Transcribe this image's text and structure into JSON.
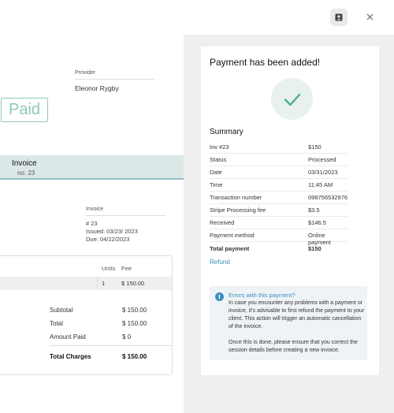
{
  "toolbar": {
    "contacts_icon": "contact-card-icon",
    "close_icon": "close-icon"
  },
  "invoice": {
    "provider_label": "Provider",
    "provider_name": "Eleonor Rygby",
    "stamp": "Paid",
    "title": "Invoice",
    "number": "no. 23",
    "meta_label": "Invoice",
    "meta": [
      "# 23",
      "Issued: 03/23/ 2023",
      "Due: 04/22/2023"
    ],
    "table": {
      "headers": [
        "Units",
        "Fee"
      ],
      "rows": [
        {
          "units": "1",
          "fee": "$ 150.00"
        }
      ]
    },
    "totals": [
      {
        "label": "Subtotal",
        "value": "$ 150.00"
      },
      {
        "label": "Total",
        "value": "$ 150.00"
      },
      {
        "label": "Amount Paid",
        "value": "$ 0"
      }
    ],
    "total_charges": {
      "label": "Total Charges",
      "value": "$ 150.00"
    }
  },
  "payment": {
    "title": "Payment has been added!",
    "summary_title": "Summary",
    "rows": [
      {
        "label": "Inv #23",
        "value": "$150"
      },
      {
        "label": "Status",
        "value": "Processed"
      },
      {
        "label": "Date",
        "value": "03/31/2023"
      },
      {
        "label": "Time",
        "value": "11:45 AM"
      },
      {
        "label": "Transaction number",
        "value": "098756532976"
      },
      {
        "label": "Stripe Processing fee",
        "value": "$3.5"
      },
      {
        "label": "Received",
        "value": "$146.5"
      },
      {
        "label": "Payment method",
        "value": "Online payment"
      },
      {
        "label": "Total payment",
        "value": "$150"
      }
    ],
    "refund_label": "Refund",
    "alert": {
      "icon": "i",
      "title": "Errors with this payment?",
      "p1": "In case you encounter any problems with a payment or invoice, it's advisable to first refund the payment to your client. This action will trigger an automatic cancellation of the invoice.",
      "p2": "Once this is done, please ensure that you correct the session details before creating a new invoice."
    }
  },
  "colors": {
    "accent": "#3a8fbf",
    "success": "#4caf8f",
    "stamp": "#8fc9b8",
    "band": "#dce8e8"
  }
}
